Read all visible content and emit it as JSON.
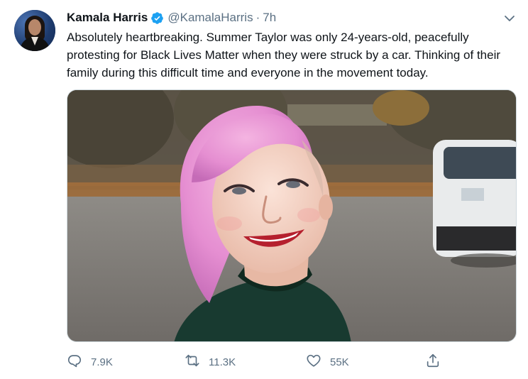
{
  "author": {
    "name": "Kamala Harris",
    "handle": "@KamalaHarris",
    "separator": "·",
    "time": "7h"
  },
  "tweet": {
    "text": "Absolutely heartbreaking. Summer Taylor was only 24-years-old, peacefully protesting for Black Lives Matter when they were struck by a car. Thinking of their family during this difficult time and everyone in the movement today."
  },
  "actions": {
    "replies": "7.9K",
    "retweets": "11.3K",
    "likes": "55K"
  },
  "icons": [
    "verified-badge-icon",
    "chevron-down-icon",
    "reply-icon",
    "retweet-icon",
    "like-icon",
    "share-icon"
  ],
  "colors": {
    "verified": "#1da1f2",
    "text": "#0f1419",
    "secondary": "#5b7083"
  }
}
